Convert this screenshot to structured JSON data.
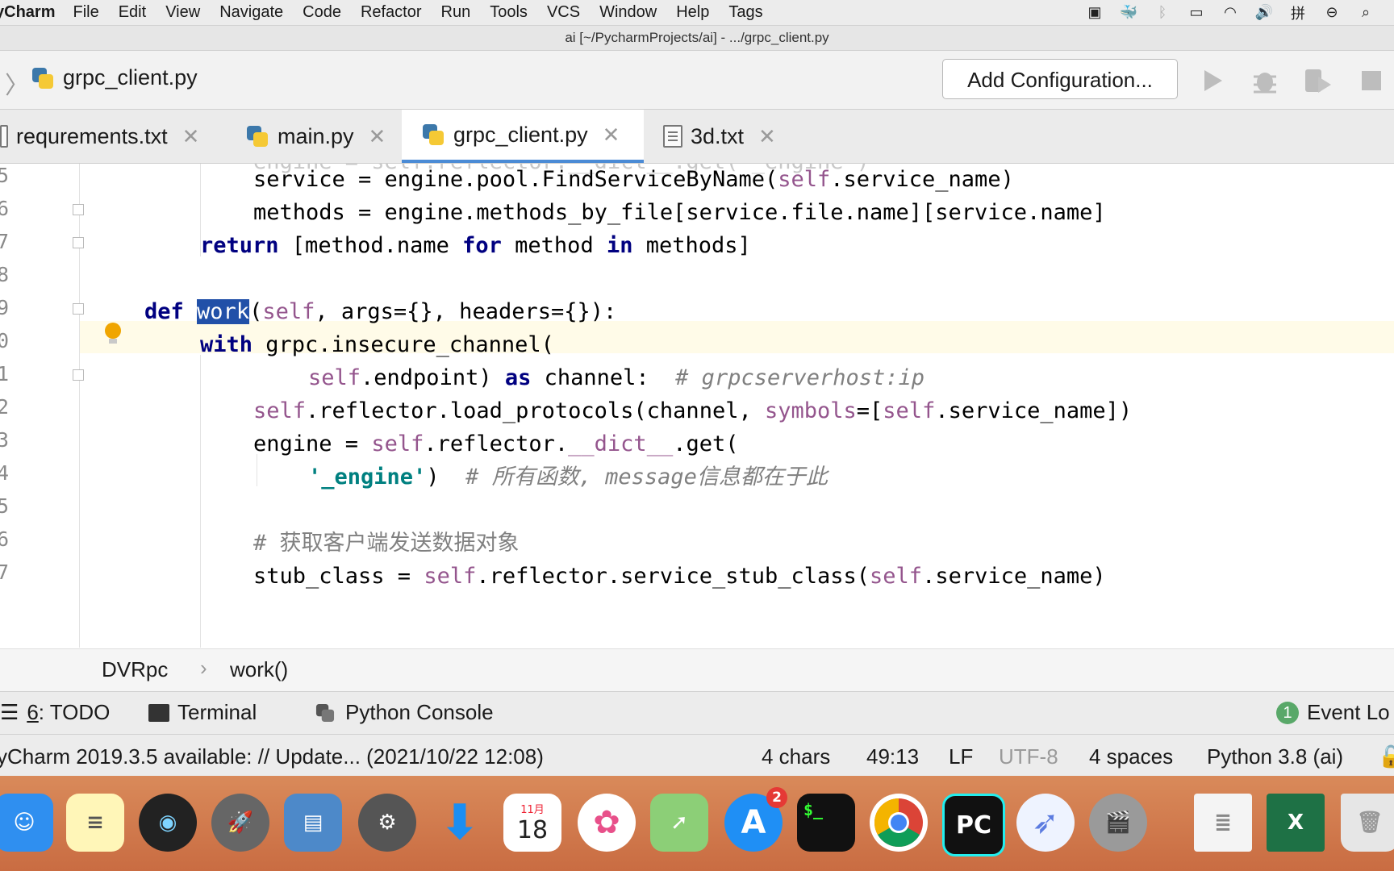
{
  "menubar": {
    "app_name": "yCharm",
    "items": [
      "File",
      "Edit",
      "View",
      "Navigate",
      "Code",
      "Refactor",
      "Run",
      "Tools",
      "VCS",
      "Window",
      "Help",
      "Tags"
    ]
  },
  "window": {
    "title": "ai [~/PycharmProjects/ai] - .../grpc_client.py"
  },
  "navbar": {
    "file_name": "grpc_client.py",
    "add_configuration_label": "Add Configuration..."
  },
  "tabs": [
    {
      "label": "requrements.txt",
      "icon": "text-file-icon"
    },
    {
      "label": "main.py",
      "icon": "python-file-icon"
    },
    {
      "label": "grpc_client.py",
      "icon": "python-file-icon",
      "active": true
    },
    {
      "label": "3d.txt",
      "icon": "text-file-icon"
    }
  ],
  "editor": {
    "line_numbers": [
      "5",
      "6",
      "7",
      "8",
      "9",
      "0",
      "1",
      "2",
      "3",
      "4",
      "5",
      "6",
      "7"
    ],
    "comments": {
      "host": "# grpcserverhost:ip",
      "engine_pre": "# 所有函数, ",
      "engine_msg": "message",
      "engine_post": "信息都在于此",
      "stub": "# 获取客户端发送数据对象"
    }
  },
  "breadcrumb": {
    "class_name": "DVRpc",
    "method_name": "work()"
  },
  "toolwindows": {
    "todo_prefix": "6",
    "todo_label": ": TODO",
    "terminal_label": "Terminal",
    "python_console_label": "Python Console",
    "event_log_count": "1",
    "event_log_label": "Event Lo"
  },
  "status": {
    "message": "yCharm 2019.3.5 available: // Update... (2021/10/22 12:08)",
    "selection": "4 chars",
    "position": "49:13",
    "line_sep": "LF",
    "encoding": "UTF-8",
    "indent": "4 spaces",
    "interpreter": "Python 3.8 (ai)"
  },
  "dock": {
    "calendar_month": "11月",
    "calendar_day": "18",
    "appstore_badge": "2",
    "terminal_text": "$_",
    "pycharm_text": "PC"
  },
  "colors": {
    "keyword": "#000080",
    "self": "#94558d",
    "comment": "#808080",
    "string": "#008080",
    "selection": "#2150a8",
    "active_tab_underline": "#4b8bd5"
  }
}
